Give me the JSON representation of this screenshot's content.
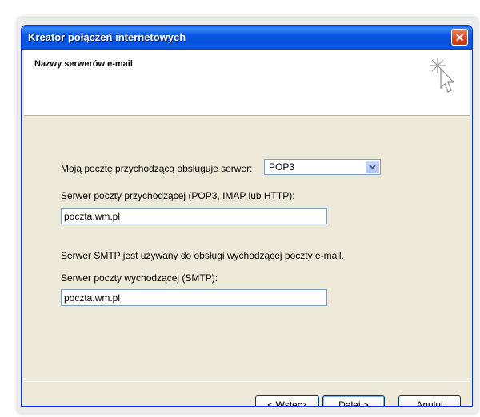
{
  "window": {
    "title": "Kreator połączeń internetowych",
    "close_glyph": "✕"
  },
  "header": {
    "title": "Nazwy serwerów e-mail",
    "icon": "wizard-cursor-icon"
  },
  "incoming_type": {
    "label": "Moją pocztę przychodzącą obsługuje serwer:",
    "selected": "POP3"
  },
  "incoming_server": {
    "label": "Serwer poczty przychodzącej (POP3, IMAP lub HTTP):",
    "value": "poczta.wm.pl"
  },
  "smtp_info": {
    "text": "Serwer SMTP jest używany do obsługi wychodzącej poczty e-mail."
  },
  "outgoing_server": {
    "label": "Serwer poczty wychodzącej (SMTP):",
    "value": "poczta.wm.pl"
  },
  "buttons": {
    "back": "< Wstecz",
    "next": "Dalej >",
    "cancel": "Anuluj"
  },
  "colors": {
    "titlebar": "#0a55e4",
    "window_bg": "#ece9d8",
    "close_button": "#d9481f"
  }
}
